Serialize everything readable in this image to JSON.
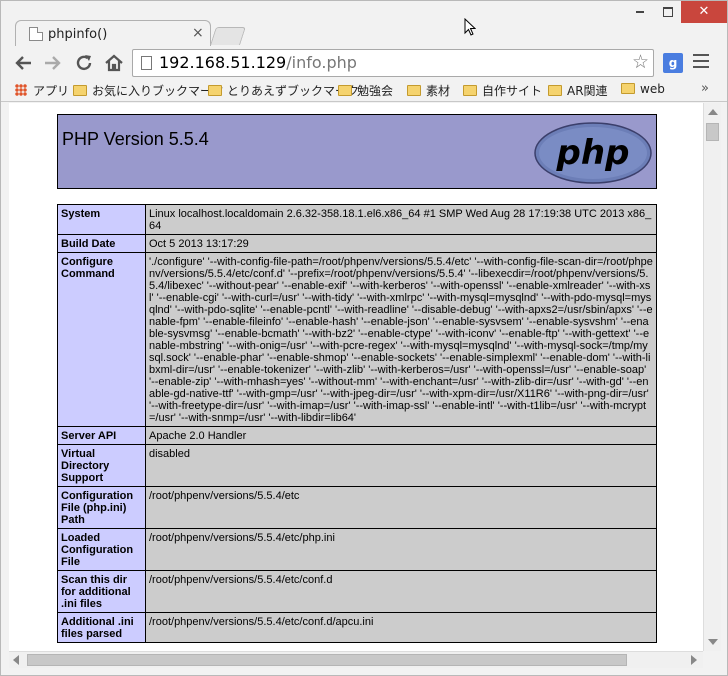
{
  "window": {
    "tab_title": "phpinfo()",
    "tab_close": "×",
    "close_glyph": "✕"
  },
  "toolbar": {
    "url_host": "192.168.51.129",
    "url_path": "/info.php",
    "extension_label": "g"
  },
  "bookmarks": [
    "アプリ",
    "お気に入りブックマーク",
    "とりあえずブックマーク",
    "勉強会",
    "素材",
    "自作サイト",
    "AR関連",
    "web"
  ],
  "bookmarks_more": "»",
  "php": {
    "version_title": "PHP Version 5.5.4",
    "logo_text": "php",
    "rows": [
      {
        "key": "System",
        "value": "Linux localhost.localdomain 2.6.32-358.18.1.el6.x86_64 #1 SMP Wed Aug 28 17:19:38 UTC 2013 x86_64"
      },
      {
        "key": "Build Date",
        "value": "Oct 5 2013 13:17:29"
      },
      {
        "key": "Configure Command",
        "value": "'./configure' '--with-config-file-path=/root/phpenv/versions/5.5.4/etc' '--with-config-file-scan-dir=/root/phpenv/versions/5.5.4/etc/conf.d' '--prefix=/root/phpenv/versions/5.5.4' '--libexecdir=/root/phpenv/versions/5.5.4/libexec' '--without-pear' '--enable-exif' '--with-kerberos' '--with-openssl' '--enable-xmlreader' '--with-xsl' '--enable-cgi' '--with-curl=/usr' '--with-tidy' '--with-xmlrpc' '--with-mysql=mysqlnd' '--with-pdo-mysql=mysqlnd' '--with-pdo-sqlite' '--enable-pcntl' '--with-readline' '--disable-debug' '--with-apxs2=/usr/sbin/apxs' '--enable-fpm' '--enable-fileinfo' '--enable-hash' '--enable-json' '--enable-sysvsem' '--enable-sysvshm' '--enable-sysvmsg' '--enable-bcmath' '--with-bz2' '--enable-ctype' '--with-iconv' '--enable-ftp' '--with-gettext' '--enable-mbstring' '--with-onig=/usr' '--with-pcre-regex' '--with-mysql=mysqlnd' '--with-mysql-sock=/tmp/mysql.sock' '--enable-phar' '--enable-shmop' '--enable-sockets' '--enable-simplexml' '--enable-dom' '--with-libxml-dir=/usr' '--enable-tokenizer' '--with-zlib' '--with-kerberos=/usr' '--with-openssl=/usr' '--enable-soap' '--enable-zip' '--with-mhash=yes' '--without-mm' '--with-enchant=/usr' '--with-zlib-dir=/usr' '--with-gd' '--enable-gd-native-ttf' '--with-gmp=/usr' '--with-jpeg-dir=/usr' '--with-xpm-dir=/usr/X11R6' '--with-png-dir=/usr' '--with-freetype-dir=/usr' '--with-imap=/usr' '--with-imap-ssl' '--enable-intl' '--with-t1lib=/usr' '--with-mcrypt=/usr' '--with-snmp=/usr' '--with-libdir=lib64'"
      },
      {
        "key": "Server API",
        "value": "Apache 2.0 Handler"
      },
      {
        "key": "Virtual Directory Support",
        "value": "disabled"
      },
      {
        "key": "Configuration File (php.ini) Path",
        "value": "/root/phpenv/versions/5.5.4/etc"
      },
      {
        "key": "Loaded Configuration File",
        "value": "/root/phpenv/versions/5.5.4/etc/php.ini"
      },
      {
        "key": "Scan this dir for additional .ini files",
        "value": "/root/phpenv/versions/5.5.4/etc/conf.d"
      },
      {
        "key": "Additional .ini files parsed",
        "value": "/root/phpenv/versions/5.5.4/etc/conf.d/apcu.ini"
      }
    ]
  },
  "colors": {
    "header_bg": "#9999cc",
    "key_bg": "#ccccff",
    "value_bg": "#cccccc",
    "close_button": "#c9463d"
  }
}
